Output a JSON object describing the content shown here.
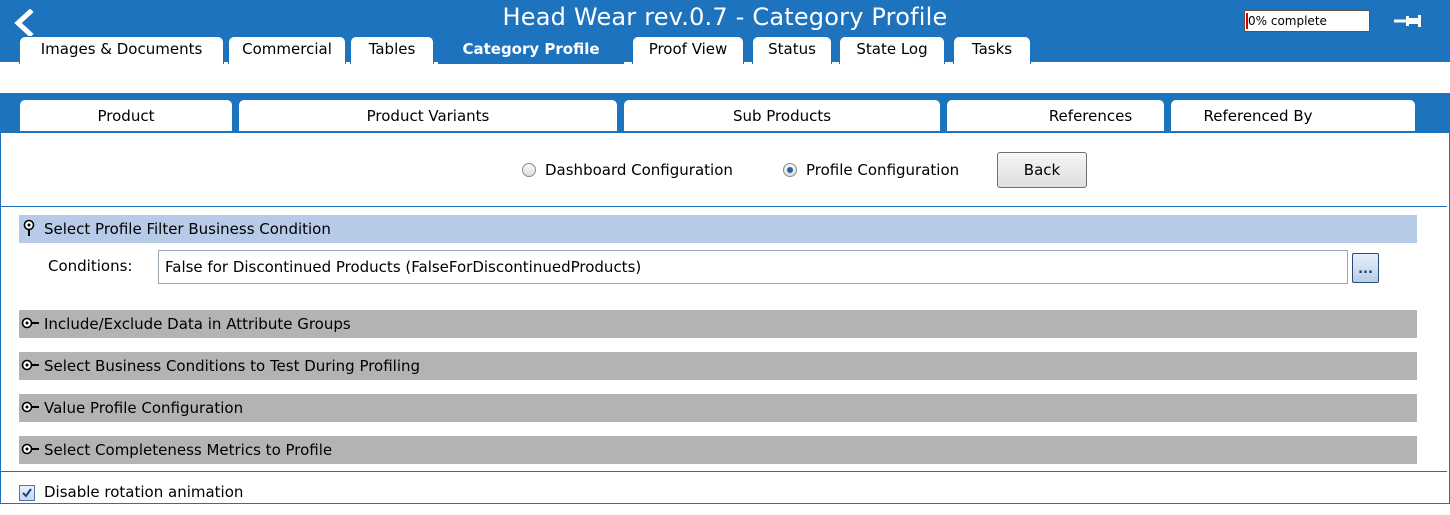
{
  "header": {
    "title": "Head Wear rev.0.7 - Category Profile",
    "progress_text": "0% complete",
    "back_icon": "chevron-left-icon",
    "pin_icon": "pin-icon"
  },
  "tabs_row1": [
    {
      "label": "Images & Documents",
      "active": false
    },
    {
      "label": "Commercial",
      "active": false
    },
    {
      "label": "Tables",
      "active": false
    },
    {
      "label": "Category Profile",
      "active": true
    },
    {
      "label": "Proof View",
      "active": false
    },
    {
      "label": "Status",
      "active": false
    },
    {
      "label": "State Log",
      "active": false
    },
    {
      "label": "Tasks",
      "active": false
    }
  ],
  "tabs_row2": [
    {
      "label": "Product"
    },
    {
      "label": "Product Variants"
    },
    {
      "label": "Sub Products"
    },
    {
      "label": "References"
    },
    {
      "label": "Referenced By"
    }
  ],
  "config_mode": {
    "options": [
      {
        "label": "Dashboard Configuration",
        "selected": false
      },
      {
        "label": "Profile Configuration",
        "selected": true
      }
    ],
    "back_label": "Back"
  },
  "sections": [
    {
      "title": "Select Profile Filter Business Condition",
      "expanded": true
    },
    {
      "title": "Include/Exclude Data in Attribute Groups",
      "expanded": false
    },
    {
      "title": "Select Business Conditions to Test During Profiling",
      "expanded": false
    },
    {
      "title": "Value Profile Configuration",
      "expanded": false
    },
    {
      "title": "Select Completeness Metrics to Profile",
      "expanded": false
    }
  ],
  "conditions": {
    "label": "Conditions:",
    "value": "False for Discontinued Products (FalseForDiscontinuedProducts)",
    "browse_label": "..."
  },
  "options": {
    "disable_rotation_label": "Disable rotation animation",
    "disable_rotation_checked": true
  },
  "colors": {
    "header_blue": "#1e73be",
    "expanded_section": "#b7cae8",
    "collapsed_section": "#b3b3b3"
  }
}
